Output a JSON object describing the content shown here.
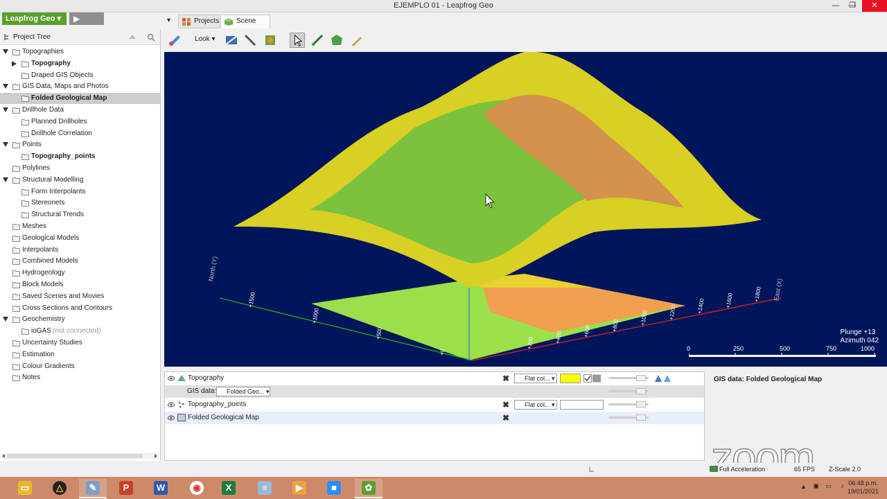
{
  "window": {
    "title": "EJEMPLO 01 - Leapfrog Geo",
    "minimize": "—",
    "restore": "❐",
    "close": "✕"
  },
  "app": {
    "badge": "Leapfrog Geo ▾",
    "play": "▶"
  },
  "tabs": {
    "dropdown": "▾",
    "projects": "Projects",
    "scene_view": "Scene View"
  },
  "toolbar": {
    "look_label": "Look ▾"
  },
  "project_tree": {
    "header": "Project Tree",
    "items": [
      {
        "label": "Topographies"
      },
      {
        "label": "Topography"
      },
      {
        "label": "Draped GIS Objects"
      },
      {
        "label": "GIS Data, Maps and Photos"
      },
      {
        "label": "Folded Geological Map"
      },
      {
        "label": "Drillhole Data"
      },
      {
        "label": "Planned Drillholes"
      },
      {
        "label": "Drillhole Correlation"
      },
      {
        "label": "Points"
      },
      {
        "label": "Topography_points"
      },
      {
        "label": "Polylines"
      },
      {
        "label": "Structural Modelling"
      },
      {
        "label": "Form Interpolants"
      },
      {
        "label": "Stereonets"
      },
      {
        "label": "Structural Trends"
      },
      {
        "label": "Meshes"
      },
      {
        "label": "Geological Models"
      },
      {
        "label": "Interpolants"
      },
      {
        "label": "Combined Models"
      },
      {
        "label": "Hydrogeology"
      },
      {
        "label": "Block Models"
      },
      {
        "label": "Saved Scenes and Movies"
      },
      {
        "label": "Cross Sections and Contours"
      },
      {
        "label": "Geochemistry"
      },
      {
        "label": "ioGAS",
        "note": "(not connected)"
      },
      {
        "label": "Uncertainty Studies"
      },
      {
        "label": "Estimation"
      },
      {
        "label": "Colour Gradients"
      },
      {
        "label": "Notes"
      }
    ]
  },
  "scene": {
    "plunge": "Plunge +13",
    "azimuth": "Azimuth 042",
    "scale_ticks": [
      "0",
      "250",
      "500",
      "750",
      "1000"
    ],
    "axis_north": "North (Y)",
    "axis_east": "East (X)",
    "north_ticks": [
      "+1500",
      "+1000",
      "+500",
      "+0"
    ],
    "east_ticks": [
      "+200",
      "+400",
      "+600",
      "+800",
      "+1000",
      "+1200",
      "+1400",
      "+1600",
      "+1800"
    ]
  },
  "shapes_list": {
    "rows": [
      {
        "name": "Topography",
        "display": "Flat col... ▾",
        "color": "#ffff00"
      },
      {
        "sub_label": "GIS data:",
        "sub_value": "Folded Geo... ▾"
      },
      {
        "name": "Topography_points",
        "display": "Flat col... ▾",
        "color": "#ffffff"
      },
      {
        "name": "Folded Geological Map"
      }
    ]
  },
  "properties": {
    "title": "GIS data: Folded Geological Map"
  },
  "status": {
    "acceleration": "Full Acceleration",
    "fps": "65 FPS",
    "zscale": "Z-Scale 2.0"
  },
  "taskbar": {
    "time": "06:48 p.m.",
    "date": "19/01/2021"
  },
  "watermark": "zoom"
}
